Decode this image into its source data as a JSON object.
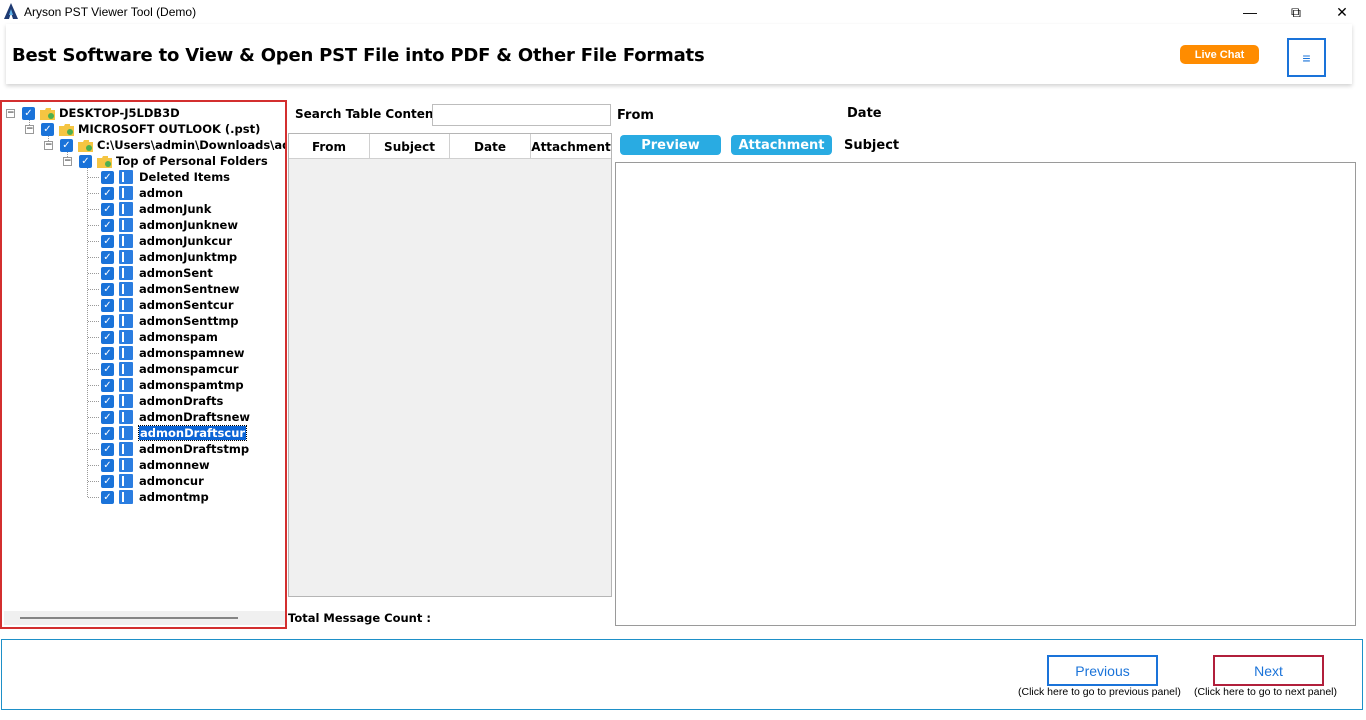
{
  "window": {
    "title": "Aryson PST Viewer Tool (Demo)",
    "minimize": "—",
    "maximize": "⧉",
    "close": "✕"
  },
  "header": {
    "title": "Best Software to View & Open PST File into PDF & Other File Formats",
    "live_chat": "Live Chat",
    "menu_icon": "≡"
  },
  "tree": {
    "root": "DESKTOP-J5LDB3D",
    "store": "MICROSOFT OUTLOOK (.pst)",
    "path": "C:\\Users\\admin\\Downloads\\adm",
    "top_folder": "Top of Personal Folders",
    "folders": [
      "Deleted Items",
      "admon",
      "admonJunk",
      "admonJunknew",
      "admonJunkcur",
      "admonJunktmp",
      "admonSent",
      "admonSentnew",
      "admonSentcur",
      "admonSenttmp",
      "admonspam",
      "admonspamnew",
      "admonspamcur",
      "admonspamtmp",
      "admonDrafts",
      "admonDraftsnew",
      "admonDraftscur",
      "admonDraftstmp",
      "admonnew",
      "admoncur",
      "admontmp"
    ],
    "selected_folder": "admonDraftscur"
  },
  "messages": {
    "search_label": "Search Table Contents:",
    "search_value": "",
    "columns": [
      "From",
      "Subject",
      "Date",
      "Attachment"
    ],
    "total_label": "Total Message Count :"
  },
  "preview": {
    "from_label": "From",
    "date_label": "Date",
    "subject_label": "Subject",
    "preview_button": "Preview",
    "attachment_button": "Attachment"
  },
  "footer": {
    "previous_label": "Previous",
    "previous_hint": "(Click here to go to previous panel)",
    "next_label": "Next",
    "next_hint": "(Click here to go to next panel)"
  },
  "colors": {
    "accent_blue": "#1a73d9",
    "pill_blue": "#29abe2",
    "live_chat_orange": "#ff8c00",
    "tree_border_red": "#d32f2f",
    "next_border": "#b11f3b"
  }
}
